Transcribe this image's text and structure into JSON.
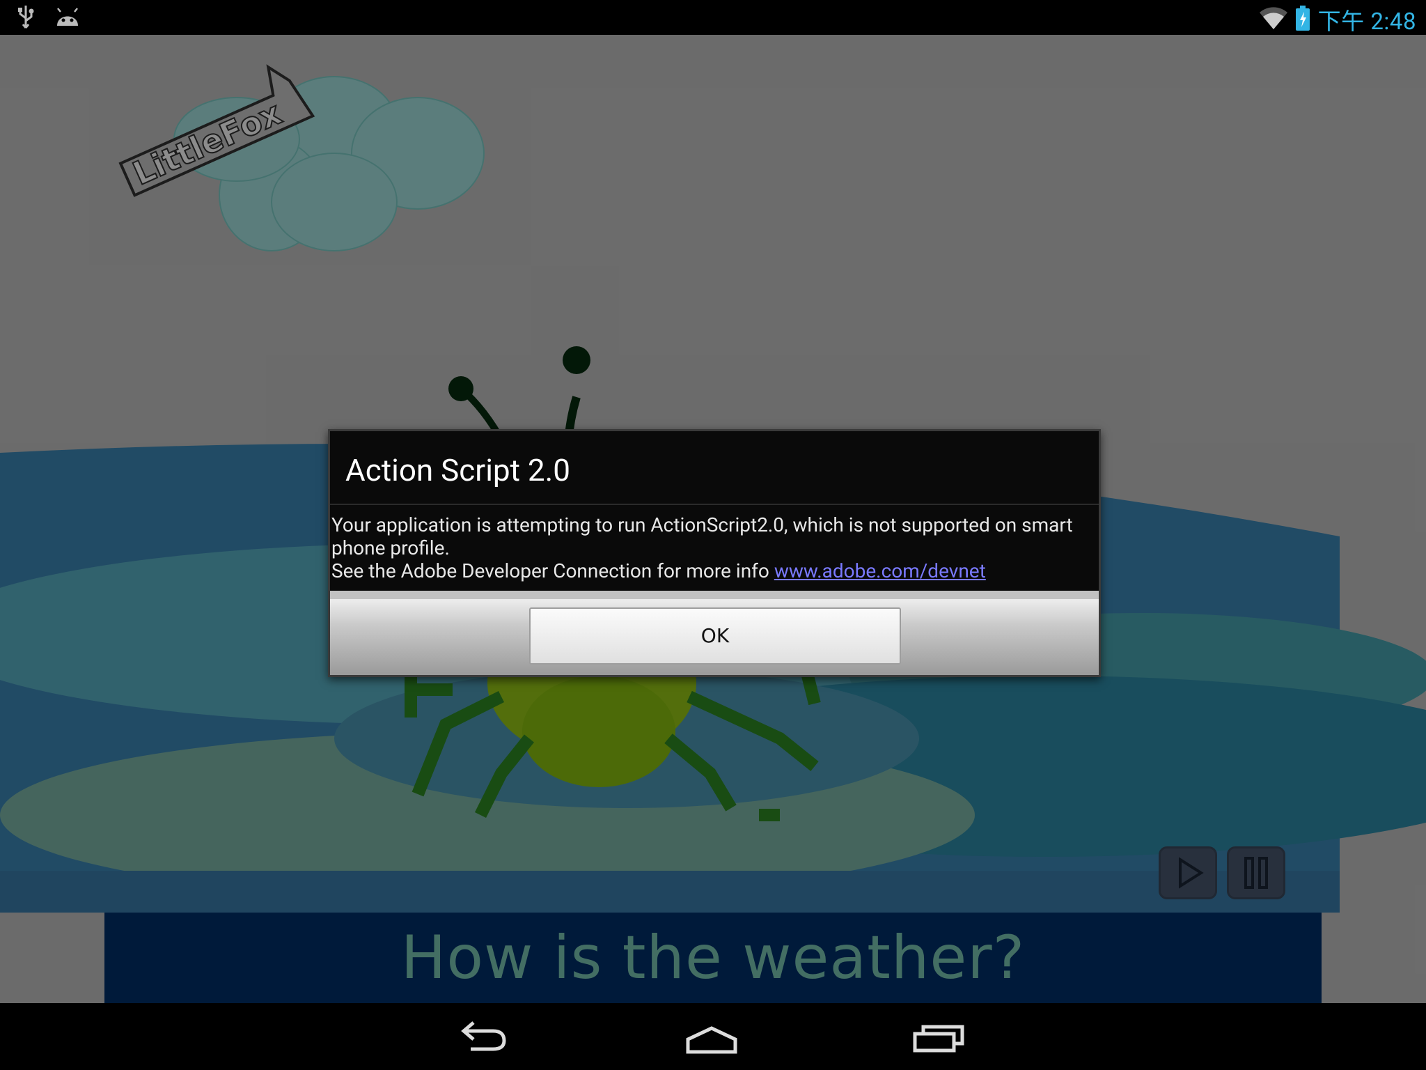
{
  "status_bar": {
    "icons_left": [
      "usb-icon",
      "android-debug-icon"
    ],
    "icons_right": [
      "wifi-icon",
      "battery-charging-icon"
    ],
    "clock": "下午 2:48"
  },
  "app": {
    "logo_text": "LittleFox",
    "subtitle": "How is the weather?",
    "controls": [
      "play-icon",
      "pause-icon"
    ]
  },
  "dialog": {
    "title": "Action Script 2.0",
    "message_line1": "Your application is attempting to run ActionScript2.0, which is not supported on smart phone profile.",
    "message_line2_prefix": "See the Adobe Developer Connection for more info ",
    "link_text": "www.adobe.com/devnet",
    "ok_label": "OK"
  },
  "nav_bar": {
    "buttons": [
      "back-icon",
      "home-icon",
      "recents-icon"
    ]
  },
  "colors": {
    "clock": "#33b5e5",
    "subtitle_bar": "#01306b",
    "subtitle_text": "#7bc8b4",
    "link": "#7a7aff"
  }
}
